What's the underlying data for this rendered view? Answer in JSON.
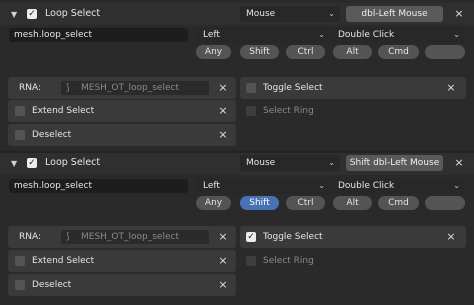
{
  "keymap_items": [
    {
      "title": "Loop Select",
      "enabled": true,
      "map_type": "Mouse",
      "key_label": "dbl-Left Mouse",
      "idname": "mesh.loop_select",
      "button": "Left",
      "event": "Double Click",
      "modifiers": [
        "Any",
        "Shift",
        "Ctrl",
        "Alt",
        "Cmd",
        ""
      ],
      "active_modifier": "",
      "rna_label": "RNA:",
      "rna_value": "MESH_OT_loop_select",
      "toggle_label": "Toggle Select",
      "toggle_checked": false,
      "extend_label": "Extend Select",
      "ring_label": "Select Ring",
      "deselect_label": "Deselect"
    },
    {
      "title": "Loop Select",
      "enabled": true,
      "map_type": "Mouse",
      "key_label": "Shift dbl-Left Mouse",
      "idname": "mesh.loop_select",
      "button": "Left",
      "event": "Double Click",
      "modifiers": [
        "Any",
        "Shift",
        "Ctrl",
        "Alt",
        "Cmd",
        ""
      ],
      "active_modifier": "Shift",
      "rna_label": "RNA:",
      "rna_value": "MESH_OT_loop_select",
      "toggle_label": "Toggle Select",
      "toggle_checked": true,
      "extend_label": "Extend Select",
      "ring_label": "Select Ring",
      "deselect_label": "Deselect"
    }
  ],
  "glyphs": {
    "expand_arrow": "▼",
    "checkmark": "✓",
    "chevron": "⌄",
    "close": "×",
    "rna_icon": "⟆"
  }
}
